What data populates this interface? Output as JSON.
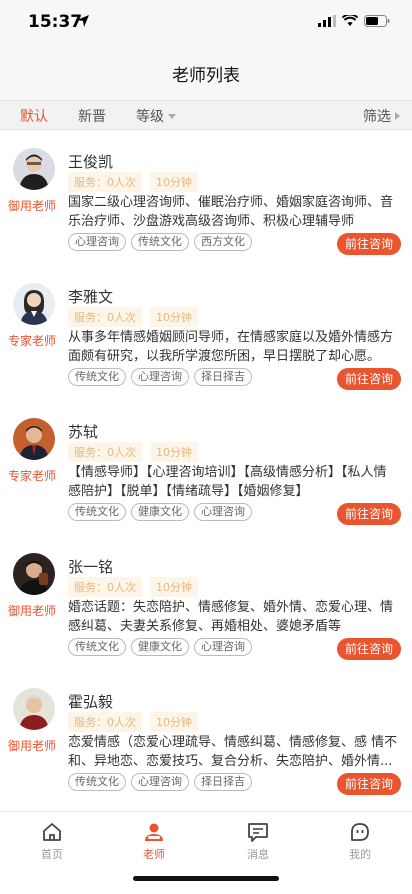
{
  "status_bar": {
    "time": "15:37"
  },
  "nav": {
    "title": "老师列表"
  },
  "filters": [
    {
      "label": "默认"
    },
    {
      "label": "新晋"
    },
    {
      "label": "等级"
    },
    {
      "label": "筛选"
    }
  ],
  "teachers": [
    {
      "name": "王俊凯",
      "role": "御用老师",
      "service": "服务：0人次",
      "duration": "10分钟",
      "desc": "国家二级心理咨询师、催眠治疗师、婚姻家庭咨询师、音乐治疗师、沙盘游戏高级咨询师、积极心理辅导师",
      "tags": [
        "心理咨询",
        "传统文化",
        "西方文化"
      ],
      "button": "前往咨询"
    },
    {
      "name": "李雅文",
      "role": "专家老师",
      "service": "服务：0人次",
      "duration": "10分钟",
      "desc": "从事多年情感婚姻顾问导师，在情感家庭以及婚外情感方面颇有研究，以我所学渡您所困，早日摆脱了却心愿。",
      "tags": [
        "传统文化",
        "心理咨询",
        "择日择吉"
      ],
      "button": "前往咨询"
    },
    {
      "name": "苏轼",
      "role": "专家老师",
      "service": "服务：0人次",
      "duration": "10分钟",
      "desc": "【情感导师】【心理咨询培训】【高级情感分析】【私人情感陪护】【脱单】【情绪疏导】【婚姻修复】",
      "tags": [
        "传统文化",
        "健康文化",
        "心理咨询"
      ],
      "button": "前往咨询"
    },
    {
      "name": "张一铭",
      "role": "御用老师",
      "service": "服务：0人次",
      "duration": "10分钟",
      "desc": "婚恋话题：失恋陪护、情感修复、婚外情、恋爱心理、情感纠葛、夫妻关系修复、再婚相处、婆媳矛盾等",
      "tags": [
        "传统文化",
        "健康文化",
        "心理咨询"
      ],
      "button": "前往咨询"
    },
    {
      "name": "霍弘毅",
      "role": "御用老师",
      "service": "服务：0人次",
      "duration": "10分钟",
      "desc": "恋爱情感（恋爱心理疏导、情感纠葛、情感修复、感 情不和、异地恋、恋爱技巧、复合分析、失恋陪护、婚外情...",
      "tags": [
        "传统文化",
        "心理咨询",
        "择日择吉"
      ],
      "button": "前往咨询"
    }
  ],
  "tabs": [
    {
      "label": "首页",
      "icon": "home-icon"
    },
    {
      "label": "老师",
      "icon": "teacher-icon"
    },
    {
      "label": "消息",
      "icon": "message-icon"
    },
    {
      "label": "我的",
      "icon": "profile-icon"
    }
  ],
  "colors": {
    "accent": "#e8552f",
    "stat_bg": "#fdf5e8",
    "stat_text": "#e9b77f"
  }
}
